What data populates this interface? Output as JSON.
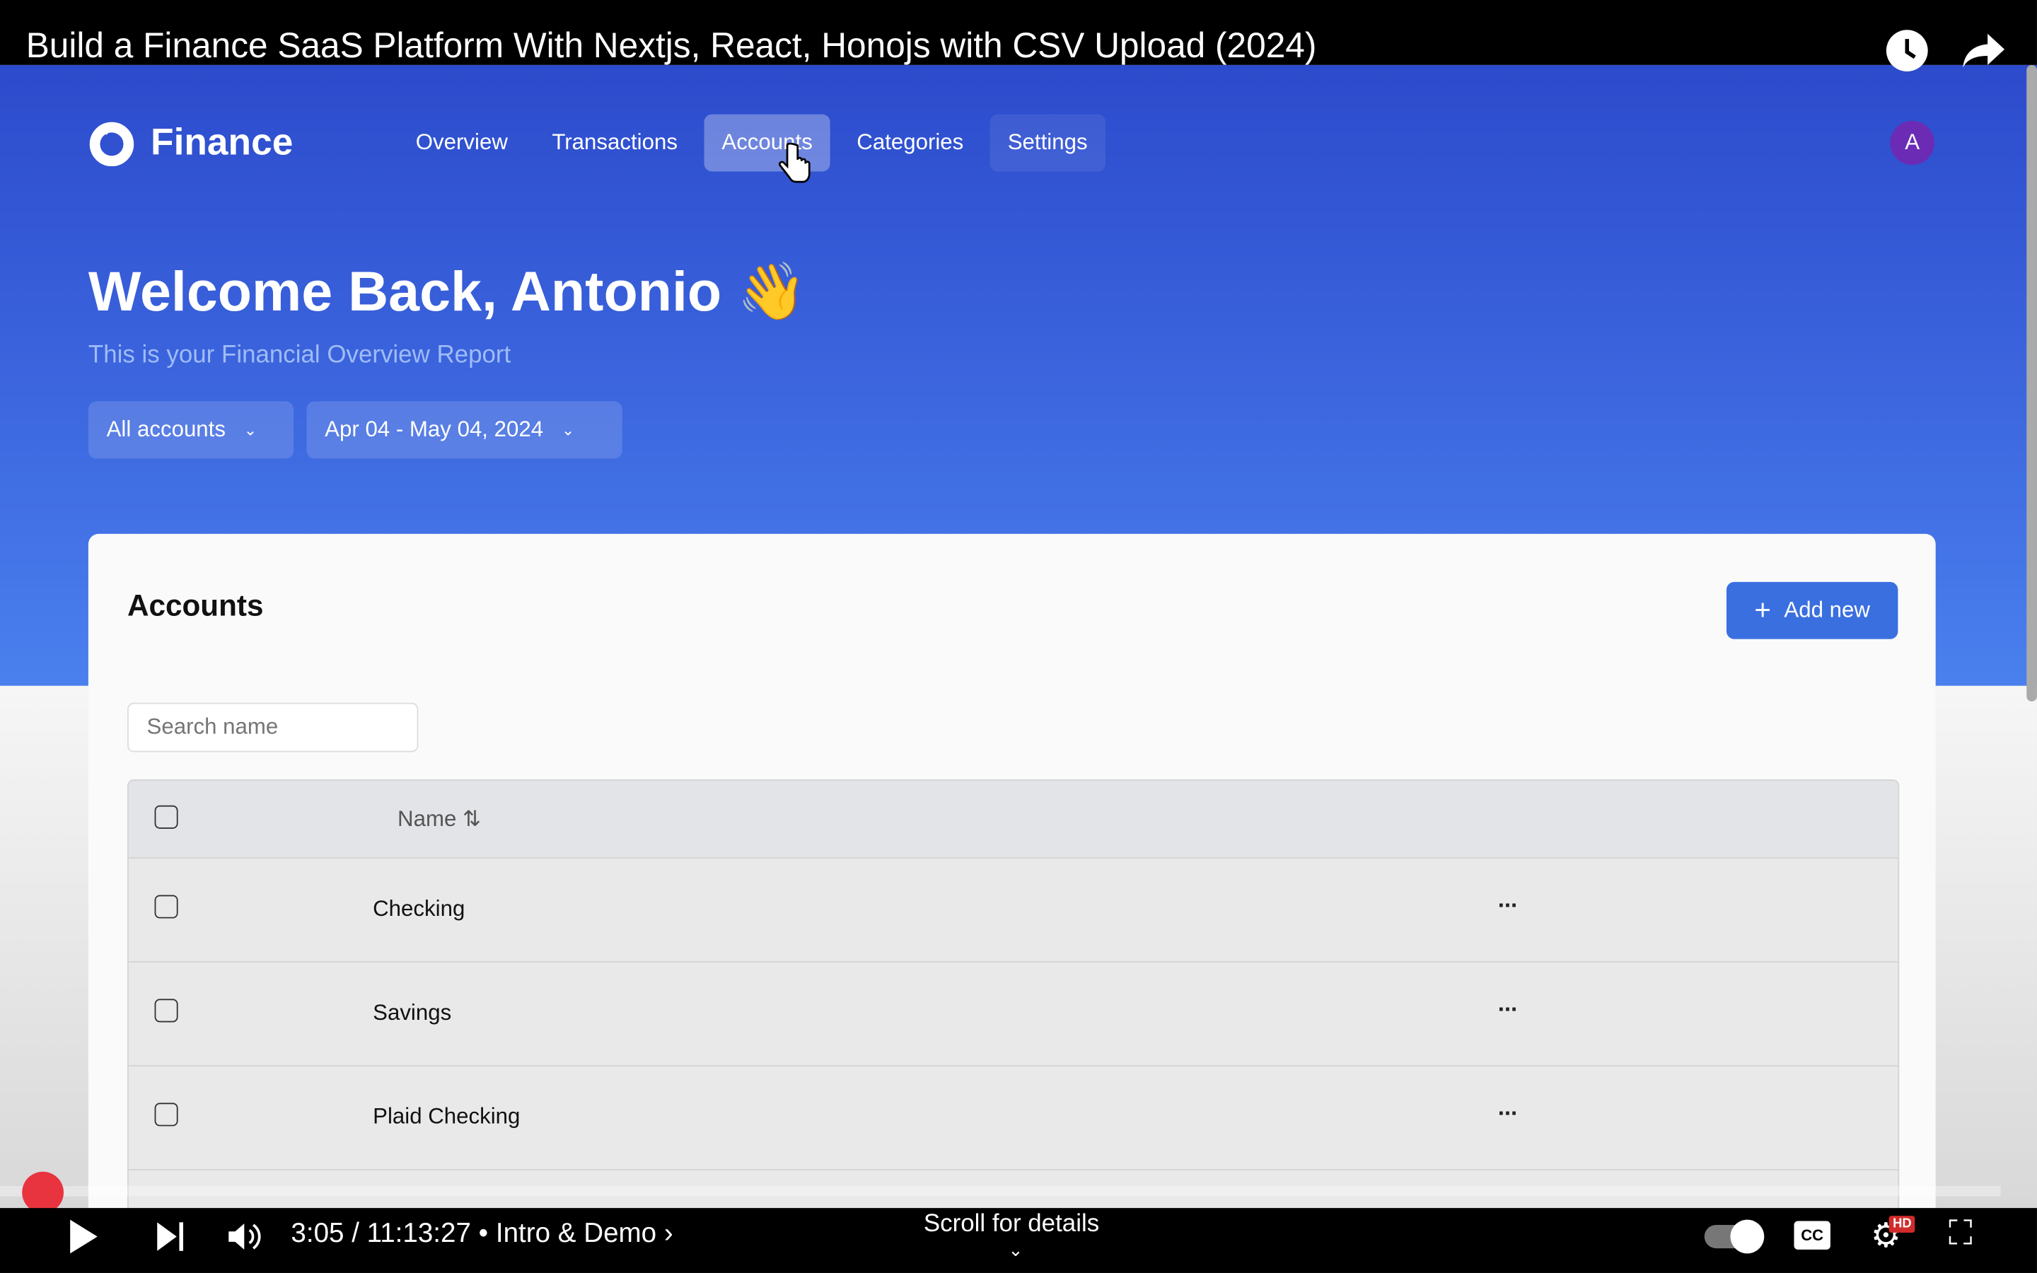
{
  "video": {
    "title": "Build a Finance SaaS Platform With Nextjs, React, Honojs with CSV Upload (2024)",
    "time": "3:05 / 11:13:27",
    "chapter": "Intro & Demo",
    "scroll_hint": "Scroll for details",
    "hd_badge": "HD",
    "cc_label": "CC",
    "progress_percent": 0.46
  },
  "app": {
    "logo": "Finance",
    "nav": [
      "Overview",
      "Transactions",
      "Accounts",
      "Categories",
      "Settings"
    ],
    "active_nav": "Accounts",
    "avatar": "A",
    "welcome": "Welcome Back, Antonio",
    "wave": "👋",
    "subtitle": "This is your Financial Overview Report",
    "filters": {
      "account": "All accounts",
      "date": "Apr 04 - May 04, 2024"
    }
  },
  "accounts": {
    "title": "Accounts",
    "add_label": "Add new",
    "search_placeholder": "Search name",
    "column_name": "Name",
    "rows": [
      "Checking",
      "Savings",
      "Plaid Checking"
    ],
    "row_menu": "···"
  },
  "colors": {
    "brand": "#3a62dc",
    "progress": "#e8343f"
  }
}
